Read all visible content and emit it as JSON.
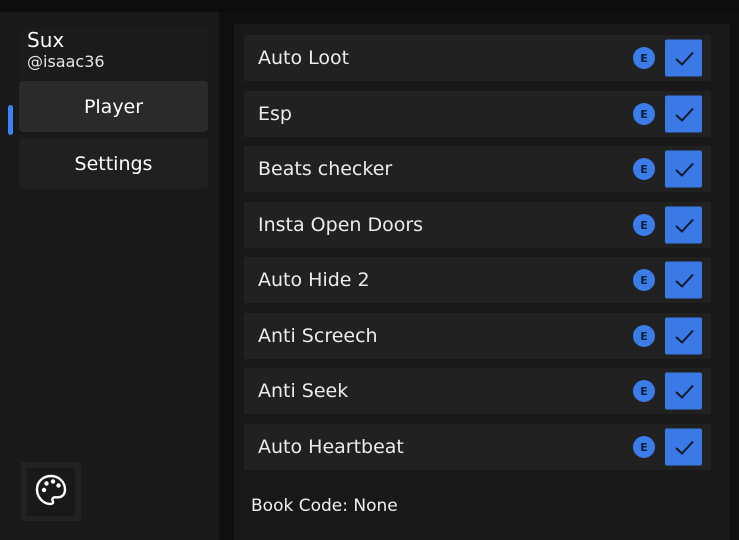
{
  "profile": {
    "name": "Sux",
    "handle": "@isaac36"
  },
  "sidebar": {
    "items": [
      {
        "label": "Player",
        "active": true
      },
      {
        "label": "Settings",
        "active": false
      }
    ],
    "theme_button_icon": "palette-icon"
  },
  "accent_color": "#3b82f6",
  "toggles": [
    {
      "label": "Auto Loot",
      "keybind": "E",
      "checked": true
    },
    {
      "label": "Esp",
      "keybind": "E",
      "checked": true
    },
    {
      "label": "Beats checker",
      "keybind": "E",
      "checked": true
    },
    {
      "label": "Insta Open Doors",
      "keybind": "E",
      "checked": true
    },
    {
      "label": "Auto Hide 2",
      "keybind": "E",
      "checked": true
    },
    {
      "label": "Anti Screech",
      "keybind": "E",
      "checked": true
    },
    {
      "label": "Anti Seek",
      "keybind": "E",
      "checked": true
    },
    {
      "label": "Auto Heartbeat",
      "keybind": "E",
      "checked": true
    }
  ],
  "book_code": "Book Code: None"
}
